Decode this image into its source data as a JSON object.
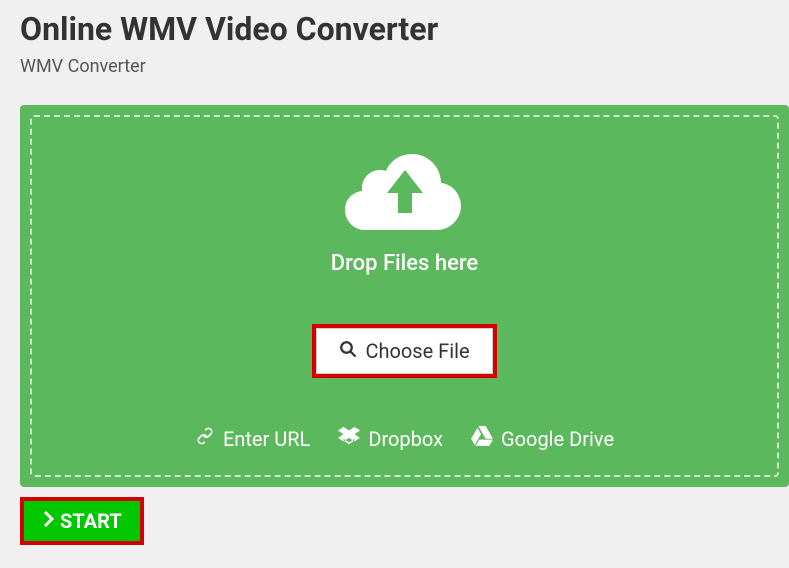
{
  "page": {
    "title": "Online WMV Video Converter",
    "subtitle": "WMV Converter"
  },
  "drop": {
    "text": "Drop Files here",
    "choose_label": "Choose File"
  },
  "sources": {
    "url": "Enter URL",
    "dropbox": "Dropbox",
    "gdrive": "Google Drive"
  },
  "actions": {
    "start": "START"
  }
}
